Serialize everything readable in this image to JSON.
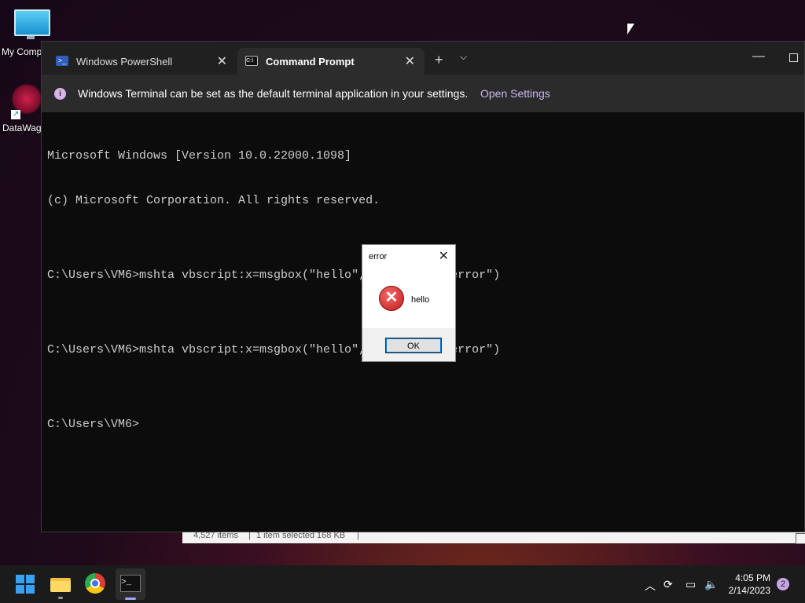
{
  "desktop": {
    "icons": [
      {
        "label": "My Comp"
      },
      {
        "label": "DataWag"
      }
    ]
  },
  "explorer_status": {
    "items": "4,527 items",
    "selected": "1 item selected  168 KB"
  },
  "terminal": {
    "tabs": [
      {
        "label": "Windows PowerShell",
        "icon": "powershell-icon",
        "active": false
      },
      {
        "label": "Command Prompt",
        "icon": "cmd-icon",
        "active": true
      }
    ],
    "new_tab": "+",
    "dropdown": "⌵",
    "info_bar": {
      "message": "Windows Terminal can be set as the default terminal application in your settings.",
      "link": "Open Settings"
    },
    "console_lines": [
      "Microsoft Windows [Version 10.0.22000.1098]",
      "(c) Microsoft Corporation. All rights reserved.",
      "",
      "C:\\Users\\VM6>mshta vbscript:x=msgbox(\"hello\",vbCritical,\"error\")",
      "",
      "C:\\Users\\VM6>mshta vbscript:x=msgbox(\"hello\",vbCritical,\"error\")",
      "",
      "C:\\Users\\VM6>"
    ]
  },
  "message_box": {
    "title": "error",
    "message": "hello",
    "ok_label": "OK",
    "icon": "error-icon"
  },
  "taskbar": {
    "clock_time": "4:05 PM",
    "clock_date": "2/14/2023",
    "notification_count": "2",
    "accent_color": "#3aa0f0"
  }
}
